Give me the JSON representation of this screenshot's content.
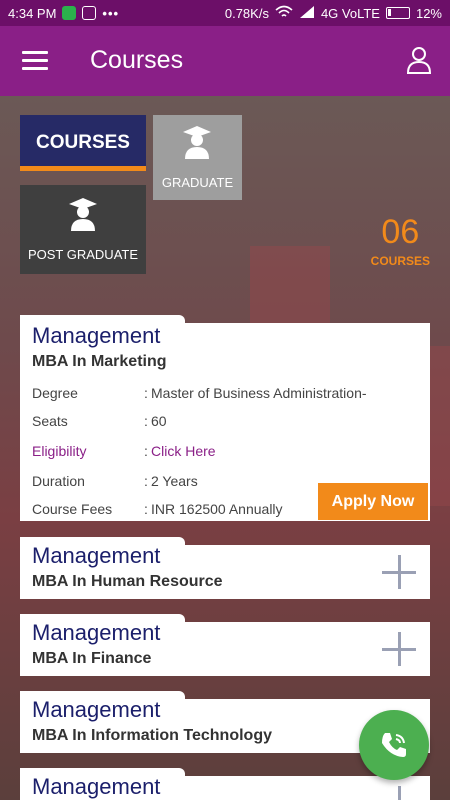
{
  "status_bar": {
    "time": "4:34 PM",
    "dots": "•••",
    "speed": "0.78K/s",
    "network": "4G VoLTE",
    "battery": "12%"
  },
  "app_bar": {
    "title": "Courses"
  },
  "tiles": {
    "courses": "COURSES",
    "graduate": "GRADUATE",
    "post_graduate": "POST GRADUATE"
  },
  "course_count": {
    "number": "06",
    "label": "COURSES"
  },
  "expanded_course": {
    "category": "Management",
    "program": "MBA In Marketing",
    "details": [
      {
        "key": "Degree",
        "value": "Master of Business Administration-"
      },
      {
        "key": "Seats",
        "value": "60"
      },
      {
        "key": "Eligibility",
        "value": "Click Here"
      },
      {
        "key": "Duration",
        "value": "2 Years"
      },
      {
        "key": "Course Fees",
        "value": "INR 162500 Annually"
      }
    ],
    "apply_label": "Apply Now"
  },
  "collapsed_courses": [
    {
      "category": "Management",
      "program": "MBA In Human Resource"
    },
    {
      "category": "Management",
      "program": "MBA In Finance"
    },
    {
      "category": "Management",
      "program": "MBA In Information Technology"
    },
    {
      "category": "Management",
      "program": ""
    }
  ],
  "colors": {
    "status_bar": "#6c0f68",
    "app_bar": "#8a1f87",
    "accent": "#f28a1a",
    "navy": "#1b1f6b",
    "call_button": "#4caf50"
  },
  "icons": [
    "menu-icon",
    "user-icon",
    "graduate-icon",
    "plus-icon",
    "phone-icon"
  ]
}
